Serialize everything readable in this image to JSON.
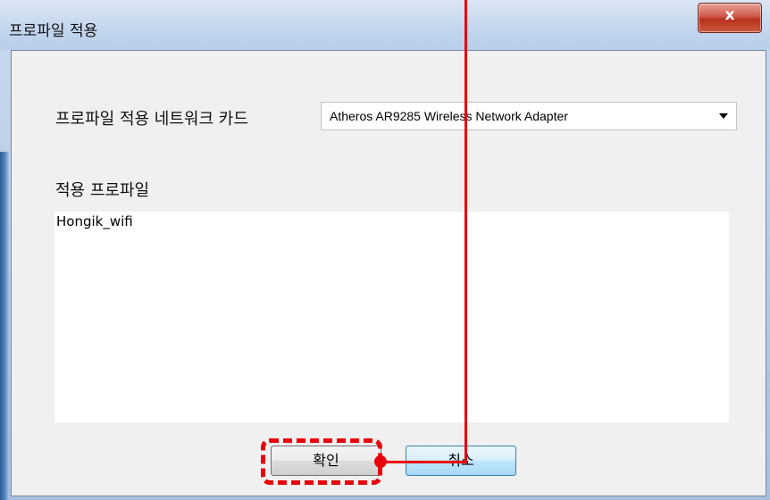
{
  "window": {
    "title": "프로파일 적용",
    "close_label": "x"
  },
  "form": {
    "adapter_label": "프로파일 적용 네트워크 카드",
    "adapter_selected": "Atheros AR9285 Wireless Network Adapter",
    "profile_label": "적용 프로파일",
    "profiles": [
      "Hongik_wifi"
    ]
  },
  "buttons": {
    "ok": "확인",
    "cancel": "취소"
  },
  "colors": {
    "annotation": "#e8000b",
    "titlebar": "#c5d7ee",
    "client_background": "#f0f0f0"
  },
  "annotation": {
    "highlighted_element": "ok-button",
    "style": "red dashed rounded rectangle with connector line"
  }
}
